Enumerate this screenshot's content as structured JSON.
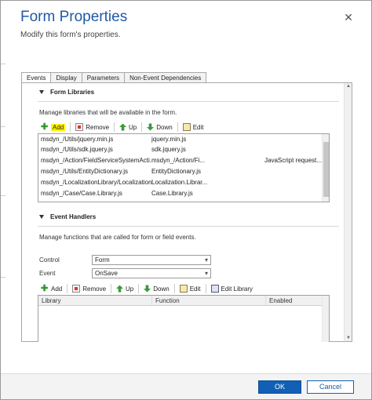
{
  "dialog": {
    "title": "Form Properties",
    "subtitle": "Modify this form's properties.",
    "close_glyph": "✕"
  },
  "tabs": [
    {
      "label": "Events",
      "active": true
    },
    {
      "label": "Display",
      "active": false
    },
    {
      "label": "Parameters",
      "active": false
    },
    {
      "label": "Non-Event Dependencies",
      "active": false
    }
  ],
  "form_libraries": {
    "heading": "Form Libraries",
    "description": "Manage libraries that will be available in the form.",
    "toolbar": {
      "add": "Add",
      "remove": "Remove",
      "up": "Up",
      "down": "Down",
      "edit": "Edit"
    },
    "rows": [
      {
        "path": "msdyn_/Utils/jquery.min.js",
        "name": "jquery.min.js",
        "desc": ""
      },
      {
        "path": "msdyn_/Utils/sdk.jquery.js",
        "name": "sdk.jquery.js",
        "desc": ""
      },
      {
        "path": "msdyn_/Action/FieldServiceSystemActi...",
        "name": "msdyn_/Action/Fi...",
        "desc": "JavaScript request..."
      },
      {
        "path": "msdyn_/Utils/EntityDictionary.js",
        "name": "EntityDictionary.js",
        "desc": ""
      },
      {
        "path": "msdyn_/LocalizationLibrary/Localization...",
        "name": "Localization.Librar...",
        "desc": ""
      },
      {
        "path": "msdyn_/Case/Case.Library.js",
        "name": "Case.Library.js",
        "desc": ""
      }
    ]
  },
  "event_handlers": {
    "heading": "Event Handlers",
    "description": "Manage functions that are called for form or field events.",
    "control_label": "Control",
    "control_value": "Form",
    "event_label": "Event",
    "event_value": "OnSave",
    "toolbar": {
      "add": "Add",
      "remove": "Remove",
      "up": "Up",
      "down": "Down",
      "edit": "Edit",
      "edit_library": "Edit Library"
    },
    "columns": [
      "Library",
      "Function",
      "Enabled"
    ]
  },
  "footer": {
    "ok": "OK",
    "cancel": "Cancel"
  },
  "colors": {
    "accent": "#1160b6",
    "title": "#1f5aa6",
    "highlight": "#fff200"
  }
}
